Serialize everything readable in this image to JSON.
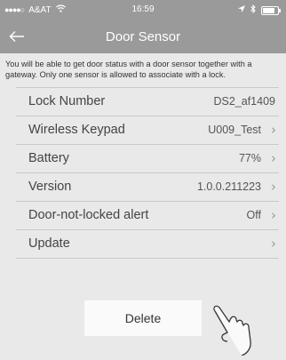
{
  "status_bar": {
    "carrier": "A&AT",
    "time": "16:59"
  },
  "header": {
    "title": "Door Sensor",
    "back_icon": "arrow-left-icon"
  },
  "info_text": "You will be able to get door status with a door sensor together with a gateway. Only one sensor is allowed to associate with a lock.",
  "rows": [
    {
      "label": "Lock Number",
      "value": "DS2_af1409",
      "chevron": false
    },
    {
      "label": "Wireless  Keypad",
      "value": "U009_Test",
      "chevron": true
    },
    {
      "label": "Battery",
      "value": "77%",
      "chevron": true
    },
    {
      "label": "Version",
      "value": "1.0.0.211223",
      "chevron": true
    },
    {
      "label": "Door-not-locked alert",
      "value": "Off",
      "chevron": true
    },
    {
      "label": "Update",
      "value": "",
      "chevron": true
    }
  ],
  "delete_label": "Delete",
  "colors": {
    "header_bg": "#9a9a9a",
    "page_bg": "#e9e9e9",
    "button_bg": "#fafafa"
  },
  "battery_level": 0.8
}
